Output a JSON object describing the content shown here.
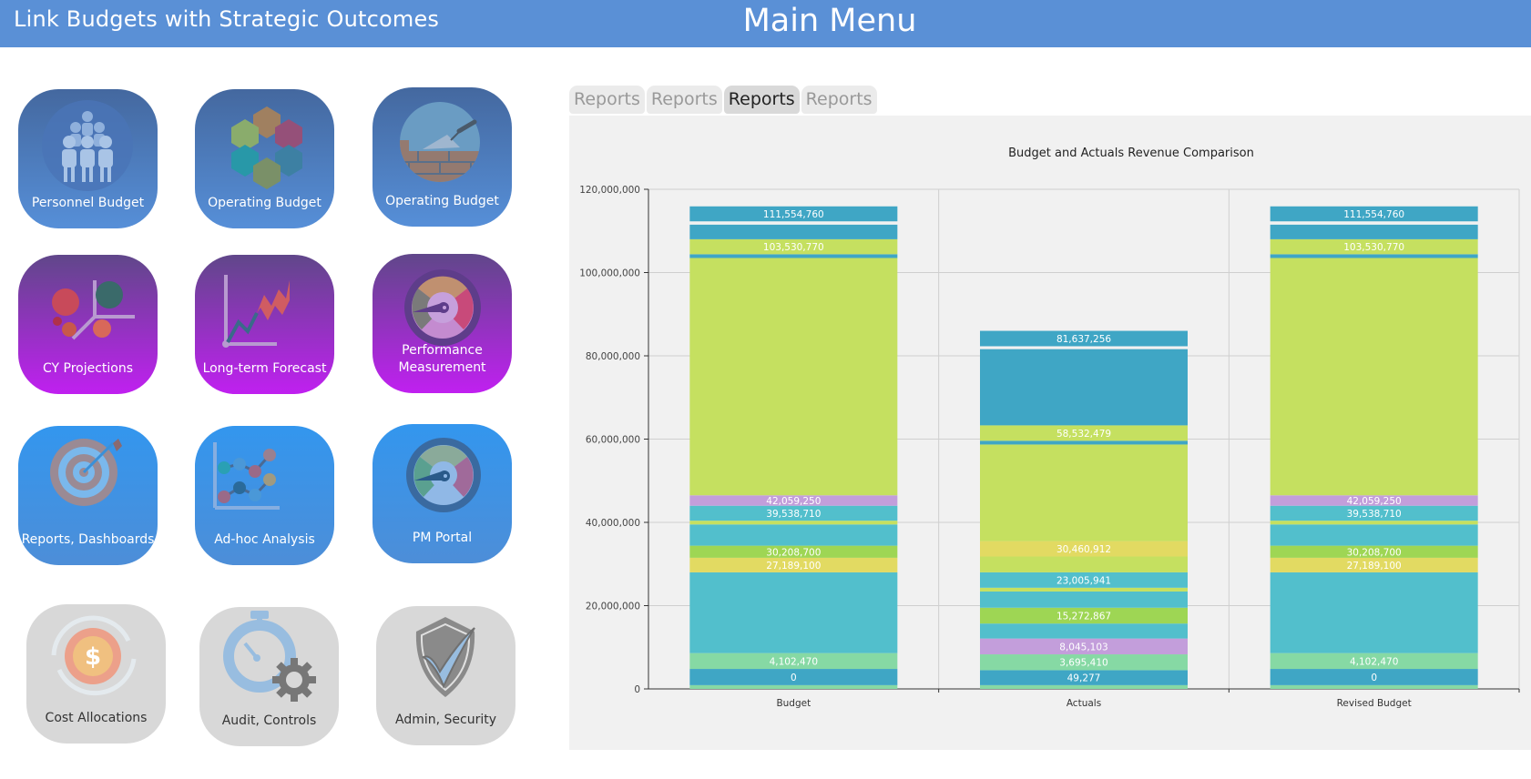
{
  "header": {
    "app_title": "Link Budgets with Strategic Outcomes",
    "page_title": "Main Menu"
  },
  "tiles": [
    {
      "label": "Personnel Budget",
      "icon": "people-group-icon",
      "theme": "blue-dark"
    },
    {
      "label": "Operating Budget",
      "icon": "hexagon-ring-icon",
      "theme": "blue-dark"
    },
    {
      "label": "Operating Budget",
      "icon": "trowel-bricks-icon",
      "theme": "blue-dark"
    },
    {
      "label": "CY Projections",
      "icon": "bubble-scatter-icon",
      "theme": "purple"
    },
    {
      "label": "Long-term Forecast",
      "icon": "trend-line-icon",
      "theme": "purple"
    },
    {
      "label": "Performance Measurement",
      "icon": "gauge-icon",
      "theme": "purple"
    },
    {
      "label": "Reports, Dashboards",
      "icon": "target-arrow-icon",
      "theme": "blue-bright"
    },
    {
      "label": "Ad-hoc Analysis",
      "icon": "line-plot-icon",
      "theme": "blue-bright"
    },
    {
      "label": "PM Portal",
      "icon": "gauge-icon",
      "theme": "blue-bright"
    },
    {
      "label": "Cost Allocations",
      "icon": "dollar-cycle-icon",
      "theme": "gray"
    },
    {
      "label": "Audit, Controls",
      "icon": "stopwatch-gear-icon",
      "theme": "gray"
    },
    {
      "label": "Admin, Security",
      "icon": "shield-check-icon",
      "theme": "gray"
    }
  ],
  "tabs": [
    {
      "label": "Reports",
      "active": false
    },
    {
      "label": "Reports",
      "active": false
    },
    {
      "label": "Reports",
      "active": true
    },
    {
      "label": "Reports",
      "active": false
    }
  ],
  "colors": {
    "header": "#5a90d6",
    "seg_blue": "#3fa6c5",
    "seg_cyan": "#52bfcc",
    "seg_lime": "#c5e060",
    "seg_green": "#9ed654",
    "seg_yellow": "#e2da62",
    "seg_purple": "#c39edb",
    "seg_mint": "#86d9a4"
  },
  "chart_data": {
    "type": "bar",
    "stacked": true,
    "title": "Budget and Actuals Revenue Comparison",
    "xlabel": "",
    "ylabel": "",
    "ylim": [
      0,
      120000000
    ],
    "yticks": [
      "0",
      "20,000,000",
      "40,000,000",
      "60,000,000",
      "80,000,000",
      "100,000,000",
      "120,000,000"
    ],
    "grid": true,
    "legend": "none",
    "categories": [
      "Budget",
      "Actuals",
      "Revised Budget"
    ],
    "bars": [
      {
        "category": "Budget",
        "segments": [
          {
            "from": 0,
            "to": 900000,
            "color": "seg_mint",
            "label": ""
          },
          {
            "from": 900000,
            "to": 4800000,
            "color": "seg_blue",
            "label": "0"
          },
          {
            "from": 4800000,
            "to": 8600000,
            "color": "seg_mint",
            "label": "4,102,470"
          },
          {
            "from": 8600000,
            "to": 28000000,
            "color": "seg_cyan",
            "label": ""
          },
          {
            "from": 28000000,
            "to": 31500000,
            "color": "seg_yellow",
            "label": "27,189,100"
          },
          {
            "from": 31500000,
            "to": 34400000,
            "color": "seg_green",
            "label": "30,208,700"
          },
          {
            "from": 34400000,
            "to": 39500000,
            "color": "seg_cyan",
            "label": ""
          },
          {
            "from": 39500000,
            "to": 40400000,
            "color": "seg_lime",
            "label": ""
          },
          {
            "from": 40400000,
            "to": 44000000,
            "color": "seg_cyan",
            "label": "39,538,710"
          },
          {
            "from": 44000000,
            "to": 46500000,
            "color": "seg_purple",
            "label": "42,059,250"
          },
          {
            "from": 46500000,
            "to": 103500000,
            "color": "seg_lime",
            "label": ""
          },
          {
            "from": 103500000,
            "to": 104400000,
            "color": "seg_blue",
            "label": ""
          },
          {
            "from": 104400000,
            "to": 108000000,
            "color": "seg_lime",
            "label": "103,530,770"
          },
          {
            "from": 108000000,
            "to": 111500000,
            "color": "seg_blue",
            "label": ""
          },
          {
            "from": 112300000,
            "to": 115900000,
            "color": "seg_blue",
            "label": "111,554,760"
          }
        ]
      },
      {
        "category": "Actuals",
        "segments": [
          {
            "from": 0,
            "to": 900000,
            "color": "seg_mint",
            "label": ""
          },
          {
            "from": 900000,
            "to": 4500000,
            "color": "seg_blue",
            "label": "49,277"
          },
          {
            "from": 4500000,
            "to": 8300000,
            "color": "seg_mint",
            "label": "3,695,410"
          },
          {
            "from": 8300000,
            "to": 12100000,
            "color": "seg_purple",
            "label": "8,045,103"
          },
          {
            "from": 12100000,
            "to": 15700000,
            "color": "seg_cyan",
            "label": ""
          },
          {
            "from": 15700000,
            "to": 19500000,
            "color": "seg_green",
            "label": "15,272,867"
          },
          {
            "from": 19500000,
            "to": 23400000,
            "color": "seg_cyan",
            "label": ""
          },
          {
            "from": 23400000,
            "to": 24300000,
            "color": "seg_lime",
            "label": ""
          },
          {
            "from": 24300000,
            "to": 28000000,
            "color": "seg_cyan",
            "label": "23,005,941"
          },
          {
            "from": 28000000,
            "to": 31800000,
            "color": "seg_lime",
            "label": ""
          },
          {
            "from": 31800000,
            "to": 35500000,
            "color": "seg_yellow",
            "label": "30,460,912"
          },
          {
            "from": 35500000,
            "to": 58700000,
            "color": "seg_lime",
            "label": ""
          },
          {
            "from": 58700000,
            "to": 59600000,
            "color": "seg_blue",
            "label": ""
          },
          {
            "from": 59600000,
            "to": 63300000,
            "color": "seg_lime",
            "label": "58,532,479"
          },
          {
            "from": 63300000,
            "to": 81600000,
            "color": "seg_blue",
            "label": ""
          },
          {
            "from": 82300000,
            "to": 86000000,
            "color": "seg_blue",
            "label": "81,637,256"
          }
        ]
      },
      {
        "category": "Revised Budget",
        "segments": [
          {
            "from": 0,
            "to": 900000,
            "color": "seg_mint",
            "label": ""
          },
          {
            "from": 900000,
            "to": 4800000,
            "color": "seg_blue",
            "label": "0"
          },
          {
            "from": 4800000,
            "to": 8600000,
            "color": "seg_mint",
            "label": "4,102,470"
          },
          {
            "from": 8600000,
            "to": 28000000,
            "color": "seg_cyan",
            "label": ""
          },
          {
            "from": 28000000,
            "to": 31500000,
            "color": "seg_yellow",
            "label": "27,189,100"
          },
          {
            "from": 31500000,
            "to": 34400000,
            "color": "seg_green",
            "label": "30,208,700"
          },
          {
            "from": 34400000,
            "to": 39500000,
            "color": "seg_cyan",
            "label": ""
          },
          {
            "from": 39500000,
            "to": 40400000,
            "color": "seg_lime",
            "label": ""
          },
          {
            "from": 40400000,
            "to": 44000000,
            "color": "seg_cyan",
            "label": "39,538,710"
          },
          {
            "from": 44000000,
            "to": 46500000,
            "color": "seg_purple",
            "label": "42,059,250"
          },
          {
            "from": 46500000,
            "to": 103500000,
            "color": "seg_lime",
            "label": ""
          },
          {
            "from": 103500000,
            "to": 104400000,
            "color": "seg_blue",
            "label": ""
          },
          {
            "from": 104400000,
            "to": 108000000,
            "color": "seg_lime",
            "label": "103,530,770"
          },
          {
            "from": 108000000,
            "to": 111500000,
            "color": "seg_blue",
            "label": ""
          },
          {
            "from": 112300000,
            "to": 115900000,
            "color": "seg_blue",
            "label": "111,554,760"
          }
        ]
      }
    ]
  }
}
